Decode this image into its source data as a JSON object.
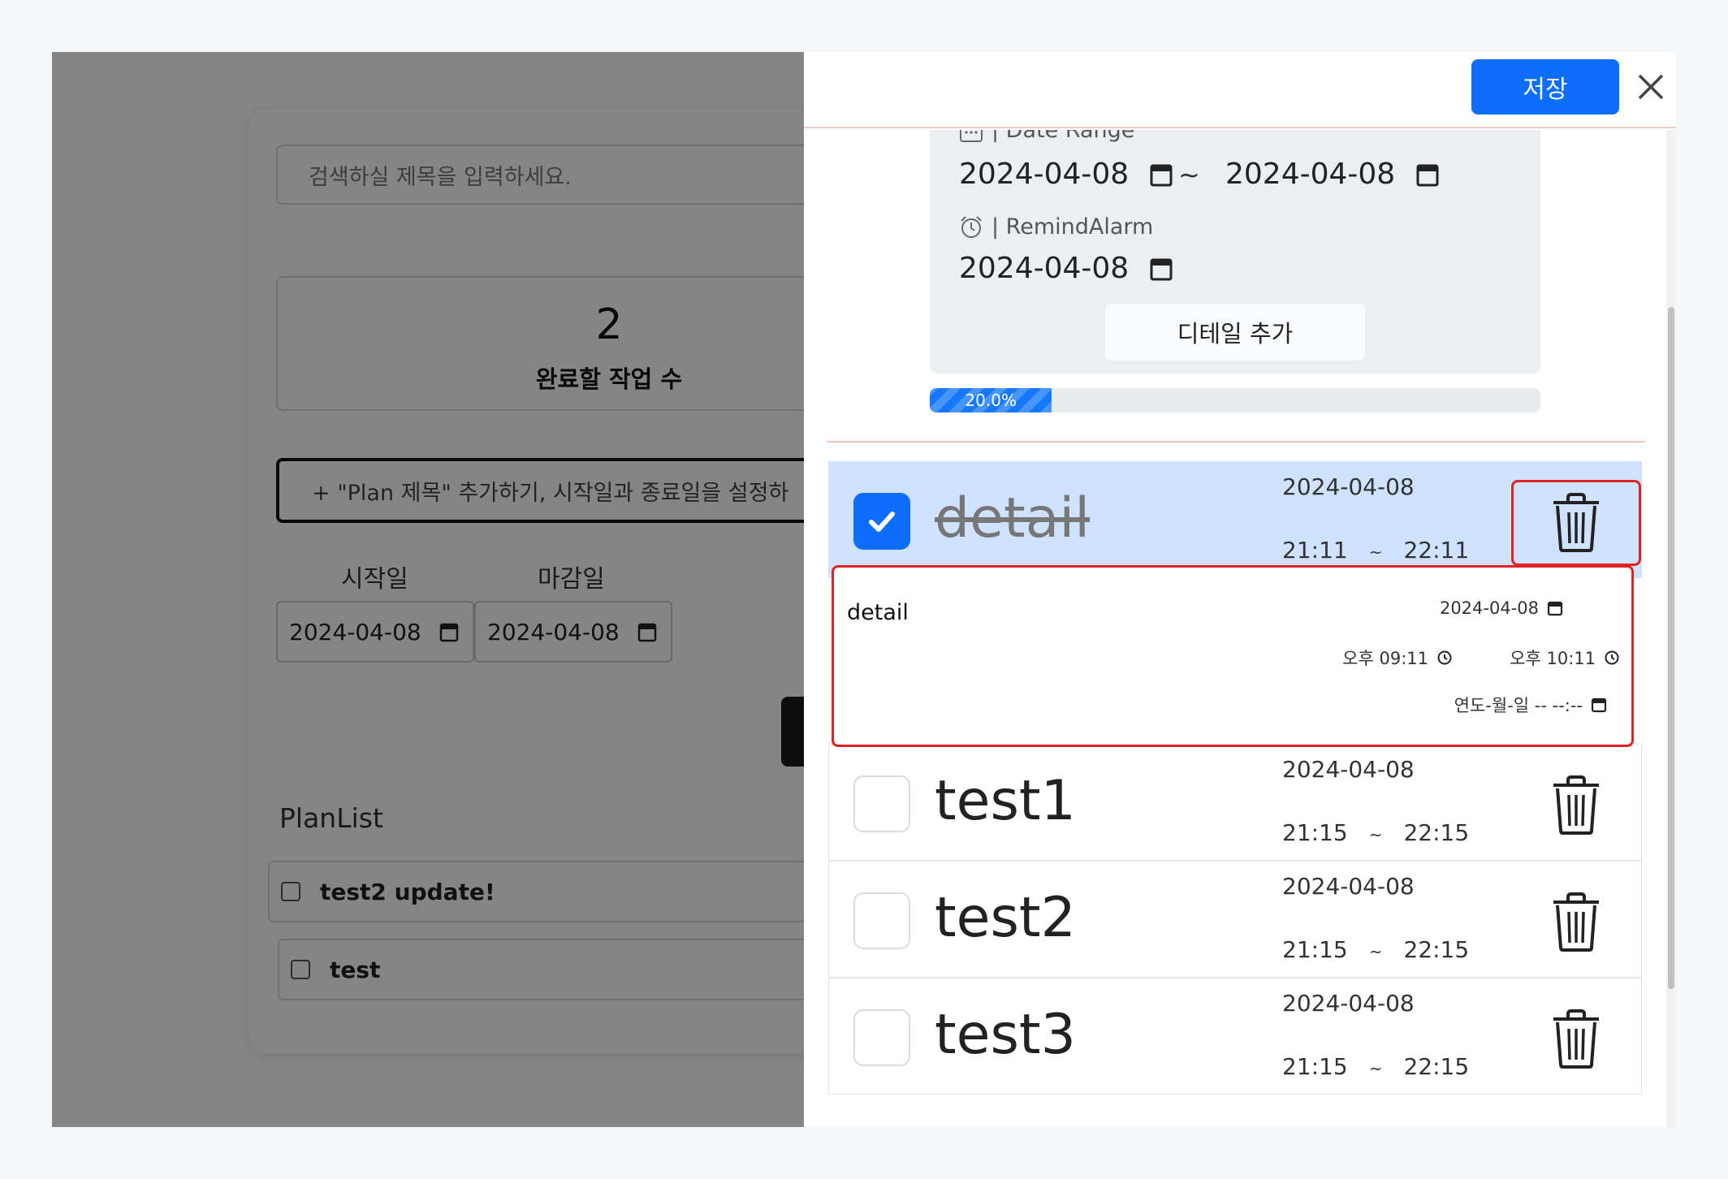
{
  "background": {
    "search_placeholder": "검색하실 제목을 입력하세요.",
    "count_number": "2",
    "count_label": "완료할 작업 수",
    "plan_input_placeholder": "+ \"Plan 제목\" 추가하기, 시작일과 종료일을 설정하",
    "start_label": "시작일",
    "end_label": "마감일",
    "start_date": "2024-04-08",
    "end_date": "2024-04-08",
    "planlist_title": "PlanList",
    "plans": [
      {
        "title": "test2 update!"
      },
      {
        "title": "test"
      }
    ]
  },
  "drawer": {
    "save_label": "저장",
    "date_range_label": "| Date Range",
    "range_start": "2024-04-08",
    "range_tilde": "~",
    "range_end": "2024-04-08",
    "remind_label": "| RemindAlarm",
    "remind_date": "2024-04-08",
    "add_detail_label": "디테일 추가",
    "progress_value": 0.2,
    "progress_label": "20.0%",
    "details": [
      {
        "title": "detail",
        "date": "2024-04-08",
        "start": "21:11",
        "end": "22:11",
        "done": true
      },
      {
        "title": "test1",
        "date": "2024-04-08",
        "start": "21:15",
        "end": "22:15",
        "done": false
      },
      {
        "title": "test2",
        "date": "2024-04-08",
        "start": "21:15",
        "end": "22:15",
        "done": false
      },
      {
        "title": "test3",
        "date": "2024-04-08",
        "start": "21:15",
        "end": "22:15",
        "done": false
      }
    ],
    "time_sep": "~",
    "editor": {
      "name": "detail",
      "date": "2024-04-08",
      "start_time": "오후 09:11",
      "end_time": "오후 10:11",
      "remind_placeholder": "연도-월-일 -- --:--"
    }
  },
  "colors": {
    "primary": "#0d6efd",
    "highlight": "#e02424",
    "done_row": "#cfe2ff"
  },
  "icons": [
    "calendar-icon",
    "alarm-icon",
    "close-icon",
    "trash-icon",
    "check-icon",
    "clock-icon"
  ]
}
